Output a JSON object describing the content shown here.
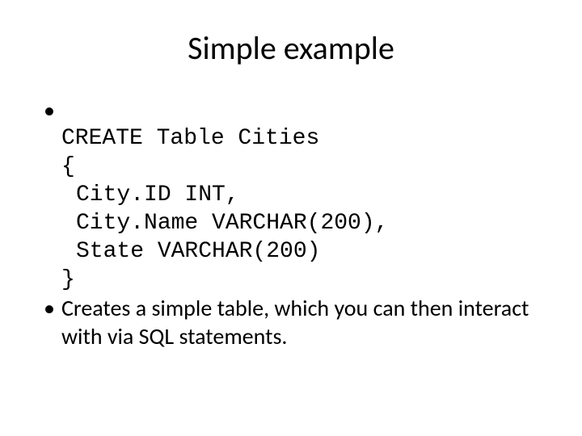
{
  "title": "Simple example",
  "bullet1": {
    "marker": "•",
    "line1": "CREATE Table Cities",
    "line2": "{",
    "line3": "City.ID INT,",
    "line4": "City.Name VARCHAR(200),",
    "line5": "State VARCHAR(200)",
    "line6": "}"
  },
  "bullet2": {
    "marker": "•",
    "text": "Creates a simple table, which you can then interact with via SQL statements."
  }
}
